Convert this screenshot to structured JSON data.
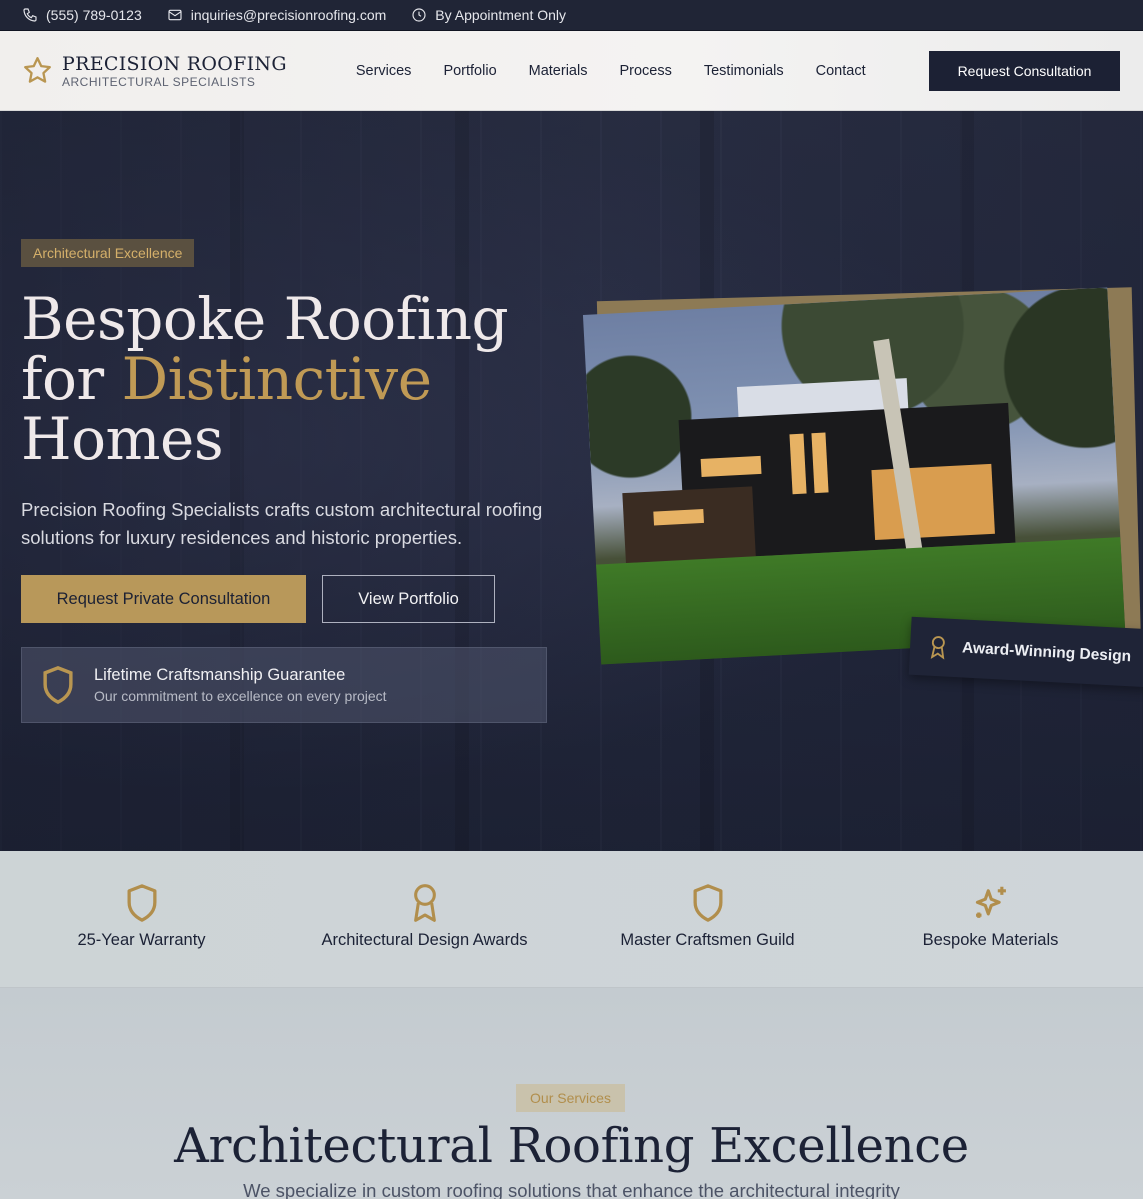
{
  "topbar": {
    "phone": "(555) 789-0123",
    "email": "inquiries@precisionroofing.com",
    "hours": "By Appointment Only"
  },
  "header": {
    "brand_name": "PRECISION ROOFING",
    "brand_tagline": "ARCHITECTURAL SPECIALISTS",
    "nav": [
      "Services",
      "Portfolio",
      "Materials",
      "Process",
      "Testimonials",
      "Contact"
    ],
    "cta": "Request Consultation"
  },
  "hero": {
    "badge": "Architectural Excellence",
    "title_line1": "Bespoke Roofing",
    "title_for": "for ",
    "title_highlight": "Distinctive",
    "title_line3": "Homes",
    "lede": "Precision Roofing Specialists crafts custom architectural roofing solutions for luxury residences and historic properties.",
    "primary_button": "Request Private Consultation",
    "secondary_button": "View Portfolio",
    "guarantee_title": "Lifetime Craftsmanship Guarantee",
    "guarantee_subtitle": "Our commitment to excellence on every project",
    "award_label": "Award-Winning Design"
  },
  "trust": [
    {
      "icon": "shield-icon",
      "label": "25-Year Warranty"
    },
    {
      "icon": "award-icon",
      "label": "Architectural Design Awards"
    },
    {
      "icon": "shield-icon",
      "label": "Master Craftsmen Guild"
    },
    {
      "icon": "sparkle-icon",
      "label": "Bespoke Materials"
    }
  ],
  "services": {
    "pill": "Our Services",
    "title": "Architectural Roofing Excellence",
    "subtitle": "We specialize in custom roofing solutions that enhance the architectural integrity"
  },
  "colors": {
    "gold": "#b99651",
    "navy": "#1c2134",
    "hero_bg": "#262b42"
  }
}
